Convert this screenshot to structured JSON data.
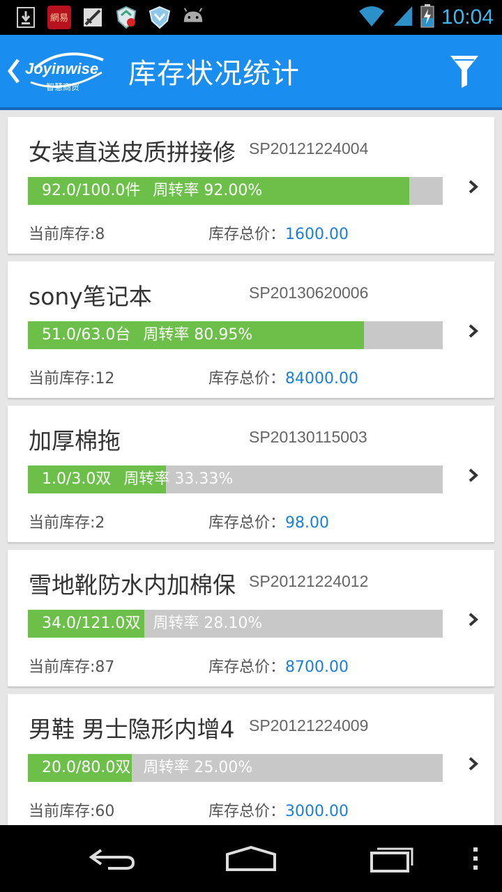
{
  "status_bar": {
    "time": "10:04",
    "left_icons": [
      "download-icon",
      "netease-app-icon",
      "no-sim-icon",
      "security-badge-icon",
      "shield-icon",
      "android-icon"
    ],
    "right_icons": [
      "wifi-icon",
      "signal-icon",
      "battery-charging-icon"
    ]
  },
  "header": {
    "back_icon": "chevron-left-icon",
    "logo_text": "Joyinwise",
    "logo_subtext": "智慧商贸",
    "title": "库存状况统计",
    "filter_icon": "filter-icon",
    "color": "#1a8ef0"
  },
  "items": [
    {
      "name": "女装直送皮质拼接修",
      "code": "SP20121224004",
      "progress_text": "92.0/100.0件",
      "turnover_text": "周转率 92.00%",
      "turnover": 0.92,
      "stock_label": "当前库存:8",
      "total_label": "库存总价：",
      "total_value": "1600.00"
    },
    {
      "name": "sony笔记本",
      "code": "SP20130620006",
      "progress_text": "51.0/63.0台",
      "turnover_text": "周转率 80.95%",
      "turnover": 0.8095,
      "stock_label": "当前库存:12",
      "total_label": "库存总价：",
      "total_value": "84000.00"
    },
    {
      "name": "加厚棉拖",
      "code": "SP20130115003",
      "progress_text": "1.0/3.0双",
      "turnover_text": "周转率 33.33%",
      "turnover": 0.3333,
      "stock_label": "当前库存:2",
      "total_label": "库存总价：",
      "total_value": "98.00"
    },
    {
      "name": "雪地靴防水内加棉保",
      "code": "SP20121224012",
      "progress_text": "34.0/121.0双",
      "turnover_text": "周转率 28.10%",
      "turnover": 0.281,
      "stock_label": "当前库存:87",
      "total_label": "库存总价：",
      "total_value": "8700.00"
    },
    {
      "name": "男鞋 男士隐形内增4",
      "code": "SP20121224009",
      "progress_text": "20.0/80.0双",
      "turnover_text": "周转率 25.00%",
      "turnover": 0.25,
      "stock_label": "当前库存:60",
      "total_label": "库存总价：",
      "total_value": "3000.00"
    }
  ],
  "nav_bar": {
    "icons": [
      "back-icon",
      "home-icon",
      "recent-apps-icon",
      "menu-icon"
    ]
  }
}
